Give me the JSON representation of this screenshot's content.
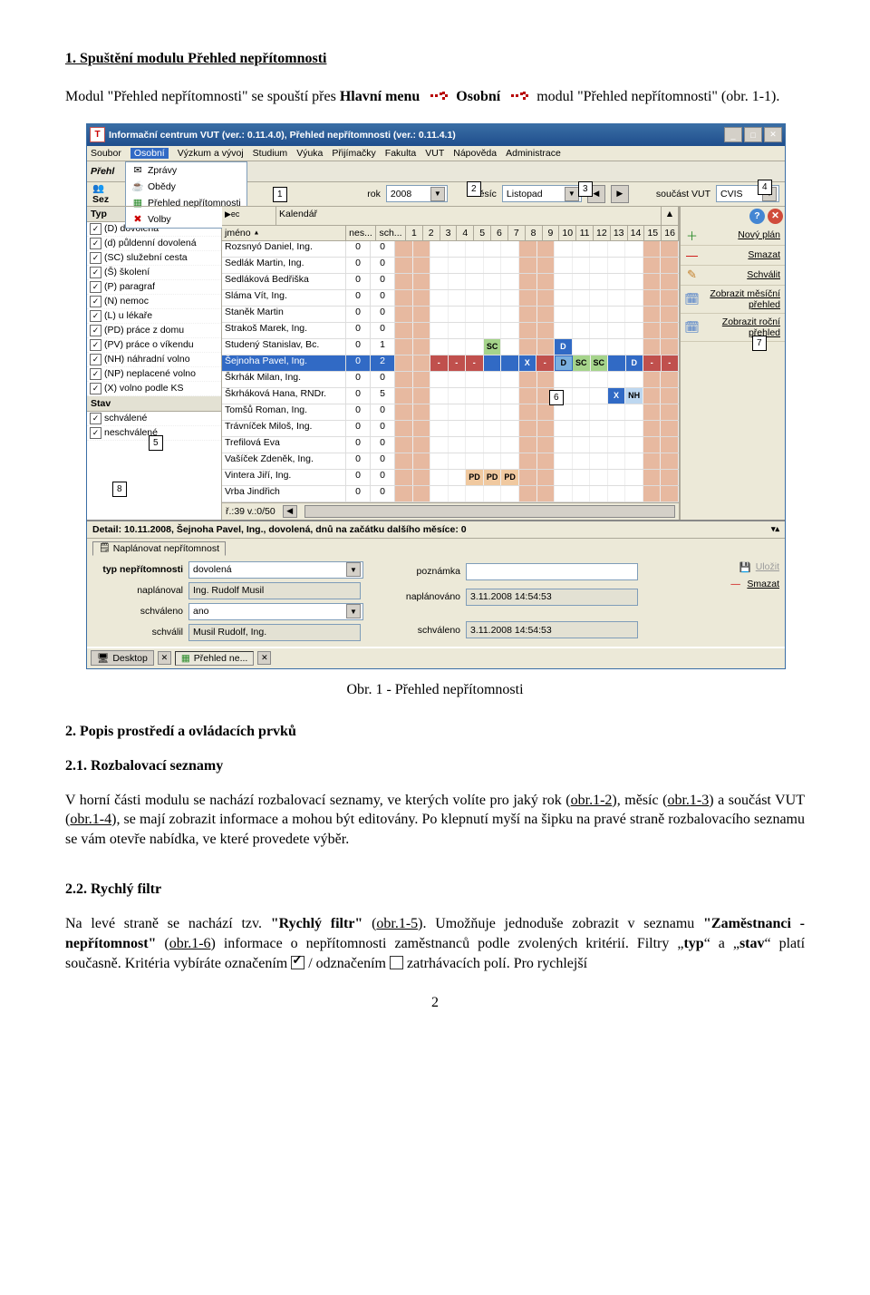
{
  "sec1": {
    "title": "1. Spuštění modulu Přehled nepřítomnosti",
    "para_a": "Modul \"Přehled nepřítomnosti\" se spouští přes ",
    "para_b": "Hlavní menu",
    "para_c": "Osobní",
    "para_d": " modul \"Přehled nepřítomnosti\" (obr. 1-1)."
  },
  "caption1": "Obr. 1 - Přehled nepřítomnosti",
  "sec2": {
    "title": "2. Popis prostředí a ovládacích prvků",
    "sub1_title": "2.1. Rozbalovací seznamy",
    "sub1_para_a": "V horní části modulu se nachází rozbalovací seznamy, ve kterých volíte pro jaký rok (",
    "sub1_para_b": "), měsíc (",
    "sub1_para_c": ") a součást VUT (",
    "sub1_para_d": "), se mají zobrazit informace a mohou být editovány. Po klepnutí myší na šipku na pravé straně rozbalovacího seznamu se vám otevře nabídka, ve které provedete výběr.",
    "ref12": "obr.1-2",
    "ref13": "obr.1-3",
    "ref14": "obr.1-4",
    "sub2_title": "2.2. Rychlý filtr",
    "sub2_para_a": "Na levé straně se nachází tzv. ",
    "sub2_para_b": "\"Rychlý filtr\"",
    "sub2_para_c": " (",
    "ref15": "obr.1-5",
    "sub2_para_d": "). Umožňuje jednoduše zobrazit v seznamu ",
    "sub2_para_e": "\"Zaměstnanci - nepřítomnost\"",
    "sub2_para_f": " (",
    "ref16": "obr.1-6",
    "sub2_para_g": ") informace o nepřítomnosti zaměstnanců podle zvolených kritérií. Filtry „",
    "sub2_para_h": "typ",
    "sub2_para_i": "“ a „",
    "sub2_para_j": "stav",
    "sub2_para_k": "“ platí současně. Kritéria vybíráte označením ",
    "sub2_para_l": " / odznačením ",
    "sub2_para_m": " zatrhávacích polí. Pro rychlejší"
  },
  "page_no": "2",
  "win": {
    "title": "Informační centrum VUT (ver.: 0.11.4.0), Přehled nepřítomnosti (ver.: 0.11.4.1)",
    "menu": [
      "Soubor",
      "Osobní",
      "Výzkum a vývoj",
      "Studium",
      "Výuka",
      "Přijímačky",
      "Fakulta",
      "VUT",
      "Nápověda",
      "Administrace"
    ],
    "standlbl": "Přehl",
    "dropdown": [
      {
        "icon": "📨",
        "label": "Zprávy"
      },
      {
        "icon": "🍲",
        "label": "Obědy",
        "color": "#c47f2a"
      },
      {
        "icon": "📗",
        "label": "Přehled nepřítomnosti",
        "color": "#2a8b2a"
      },
      {
        "icon": "✖",
        "label": "Volby",
        "color": "#c00"
      }
    ],
    "row_sez": "Sez",
    "row_typ": "Typ",
    "filters": {
      "rok_label": "rok",
      "rok": "2008",
      "mesic_label": "měsíc",
      "mesic": "Listopad",
      "soucast_label": "součást VUT",
      "soucast": "CVIS"
    },
    "group_head": "Typ",
    "kalendar": "Kalendář",
    "name_col": "jméno",
    "nes_col": "nes...",
    "sch_col": "sch...",
    "type_list": [
      "(D) dovolená",
      "(d) půldenní dovolená",
      "(SC) služební cesta",
      "(Š) školení",
      "(P) paragraf",
      "(N) nemoc",
      "(L) u lékaře",
      "(PD) práce z domu",
      "(PV) práce o víkendu",
      "(NH) náhradní volno",
      "(NP) neplacené volno",
      "(X) volno podle KS"
    ],
    "stav_label": "Stav",
    "stav_list": [
      "schválené",
      "neschválené"
    ],
    "days": [
      "1",
      "2",
      "3",
      "4",
      "5",
      "6",
      "7",
      "8",
      "9",
      "10",
      "11",
      "12",
      "13",
      "14",
      "15",
      "16"
    ],
    "employees": [
      {
        "name": "Rozsnyó Daniel, Ing.",
        "n": "0",
        "s": "0"
      },
      {
        "name": "Sedlák Martin, Ing.",
        "n": "0",
        "s": "0"
      },
      {
        "name": "Sedláková Bedřiška",
        "n": "0",
        "s": "0"
      },
      {
        "name": "Sláma Vít, Ing.",
        "n": "0",
        "s": "0"
      },
      {
        "name": "Staněk Martin",
        "n": "0",
        "s": "0"
      },
      {
        "name": "Strakoš Marek, Ing.",
        "n": "0",
        "s": "0"
      },
      {
        "name": "Studený Stanislav, Bc.",
        "n": "0",
        "s": "1"
      },
      {
        "name": "Šejnoha Pavel, Ing.",
        "n": "0",
        "s": "2",
        "sel": true
      },
      {
        "name": "Škrhák Milan, Ing.",
        "n": "0",
        "s": "0"
      },
      {
        "name": "Škrháková Hana, RNDr.",
        "n": "0",
        "s": "5"
      },
      {
        "name": "Tomšů Roman, Ing.",
        "n": "0",
        "s": "0"
      },
      {
        "name": "Trávníček Miloš, Ing.",
        "n": "0",
        "s": "0"
      },
      {
        "name": "Trefilová Eva",
        "n": "0",
        "s": "0"
      },
      {
        "name": "Vašíček Zdeněk, Ing.",
        "n": "0",
        "s": "0"
      },
      {
        "name": "Vintera Jiří, Ing.",
        "n": "0",
        "s": "0"
      },
      {
        "name": "Vrba Jindřich",
        "n": "0",
        "s": "0"
      }
    ],
    "grid_footer": "ř.:39 v.:0/50",
    "right_buttons": [
      {
        "icon": "＋",
        "label": "Nový plán",
        "u": "N",
        "col": "#2a8b2a"
      },
      {
        "icon": "—",
        "label": "Smazat",
        "u": "S",
        "col": "#c00"
      },
      {
        "icon": "✎",
        "label": "Schválit",
        "u": "S",
        "col": "#c47f2a"
      },
      {
        "icon": "🗓",
        "label": "Zobrazit měsíční přehled",
        "u": "",
        "col": "#316ac5"
      },
      {
        "icon": "🗓",
        "label": "Zobrazit roční přehled",
        "u": "",
        "col": "#316ac5"
      }
    ],
    "detail_title": "Detail: 10.11.2008, Šejnoha Pavel, Ing., dovolená, dnů na začátku dalšího měsíce: 0",
    "tab": "Naplánovat nepřítomnost",
    "frm": {
      "typ_l": "typ nepřítomnosti",
      "typ": "dovolená",
      "naplanoval_l": "naplánoval",
      "naplanoval": "Ing. Rudolf Musil",
      "schvaleno_l": "schváleno",
      "schvaleno": "ano",
      "schvalil_l": "schválil",
      "schvalil": "Musil Rudolf, Ing.",
      "pozn_l": "poznámka",
      "pozn": "",
      "naplanovano_l": "naplánováno",
      "naplanovano": "3.11.2008 14:54:53",
      "schvaleno2_l": "schváleno",
      "schvaleno2": "3.11.2008 14:54:53",
      "u_l": "Uložit",
      "s_l": "Smazat"
    },
    "taskbar": {
      "desktop": "Desktop",
      "module": "Přehled ne..."
    }
  },
  "callouts": {
    "1": "1",
    "2": "2",
    "3": "3",
    "4": "4",
    "5": "5",
    "6": "6",
    "7": "7",
    "8": "8"
  }
}
